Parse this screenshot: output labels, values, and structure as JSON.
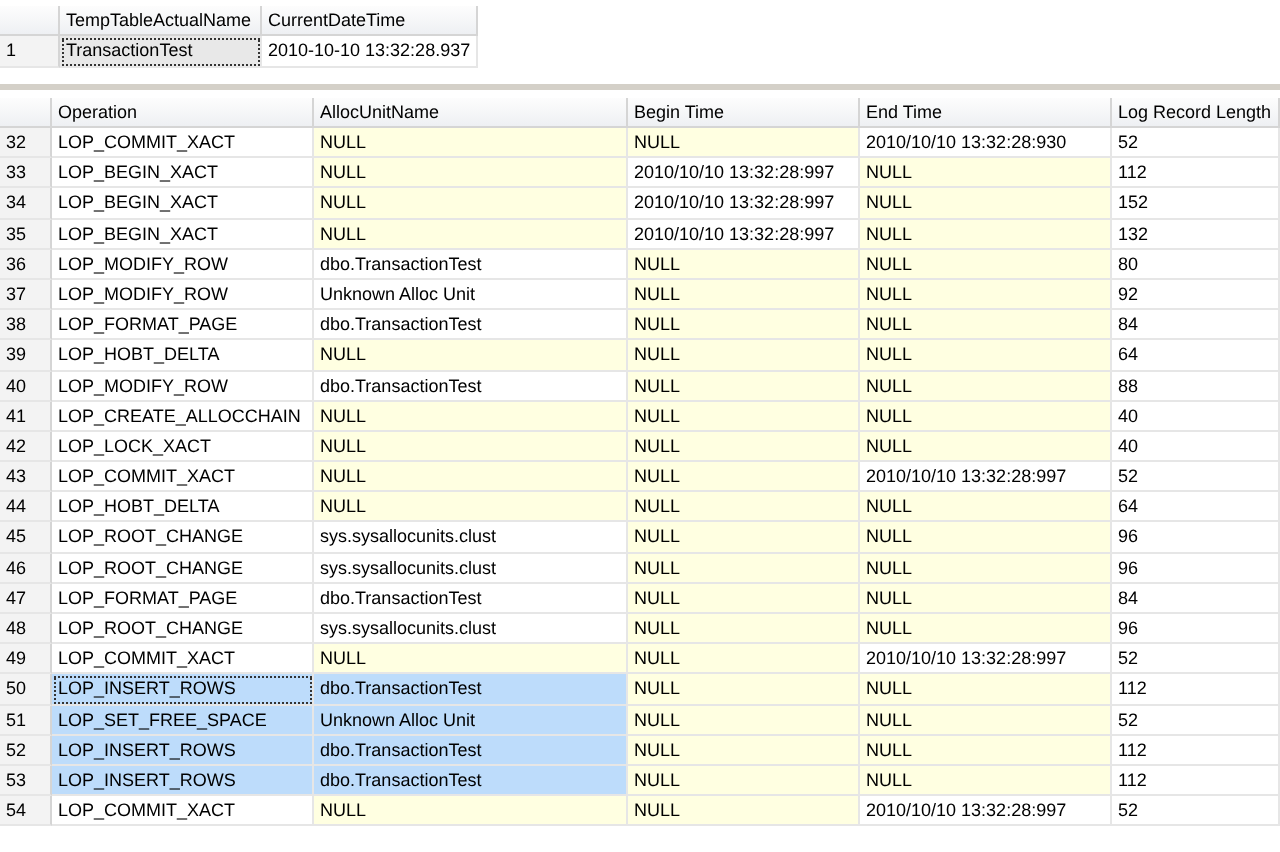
{
  "top_grid": {
    "columns": [
      {
        "label": "TempTableActualName"
      },
      {
        "label": "CurrentDateTime"
      }
    ],
    "rows": [
      {
        "num": "1",
        "cells": [
          "TransactionTest",
          "2010-10-10 13:32:28.937"
        ],
        "focused": [
          true,
          false
        ]
      }
    ]
  },
  "log_grid": {
    "columns": [
      {
        "label": "Operation",
        "selected": true
      },
      {
        "label": "AllocUnitName",
        "selected": true
      },
      {
        "label": "Begin Time",
        "selected": false
      },
      {
        "label": "End Time",
        "selected": false
      },
      {
        "label": "Log Record Length",
        "selected": false
      }
    ],
    "rows": [
      {
        "num": "32",
        "cells": [
          "LOP_COMMIT_XACT",
          "NULL",
          "NULL",
          "2010/10/10 13:32:28:930",
          "52"
        ],
        "nulls": [
          false,
          true,
          true,
          false,
          false
        ],
        "selected": false
      },
      {
        "num": "33",
        "cells": [
          "LOP_BEGIN_XACT",
          "NULL",
          "2010/10/10 13:32:28:997",
          "NULL",
          "112"
        ],
        "nulls": [
          false,
          true,
          false,
          true,
          false
        ],
        "selected": false
      },
      {
        "num": "34",
        "cells": [
          "LOP_BEGIN_XACT",
          "NULL",
          "2010/10/10 13:32:28:997",
          "NULL",
          "152"
        ],
        "nulls": [
          false,
          true,
          false,
          true,
          false
        ],
        "selected": false
      },
      {
        "num": "35",
        "cells": [
          "LOP_BEGIN_XACT",
          "NULL",
          "2010/10/10 13:32:28:997",
          "NULL",
          "132"
        ],
        "nulls": [
          false,
          true,
          false,
          true,
          false
        ],
        "selected": false
      },
      {
        "num": "36",
        "cells": [
          "LOP_MODIFY_ROW",
          "dbo.TransactionTest",
          "NULL",
          "NULL",
          "80"
        ],
        "nulls": [
          false,
          false,
          true,
          true,
          false
        ],
        "selected": false
      },
      {
        "num": "37",
        "cells": [
          "LOP_MODIFY_ROW",
          "Unknown Alloc Unit",
          "NULL",
          "NULL",
          "92"
        ],
        "nulls": [
          false,
          false,
          true,
          true,
          false
        ],
        "selected": false
      },
      {
        "num": "38",
        "cells": [
          "LOP_FORMAT_PAGE",
          "dbo.TransactionTest",
          "NULL",
          "NULL",
          "84"
        ],
        "nulls": [
          false,
          false,
          true,
          true,
          false
        ],
        "selected": false
      },
      {
        "num": "39",
        "cells": [
          "LOP_HOBT_DELTA",
          "NULL",
          "NULL",
          "NULL",
          "64"
        ],
        "nulls": [
          false,
          true,
          true,
          true,
          false
        ],
        "selected": false
      },
      {
        "num": "40",
        "cells": [
          "LOP_MODIFY_ROW",
          "dbo.TransactionTest",
          "NULL",
          "NULL",
          "88"
        ],
        "nulls": [
          false,
          false,
          true,
          true,
          false
        ],
        "selected": false
      },
      {
        "num": "41",
        "cells": [
          "LOP_CREATE_ALLOCCHAIN",
          "NULL",
          "NULL",
          "NULL",
          "40"
        ],
        "nulls": [
          false,
          true,
          true,
          true,
          false
        ],
        "selected": false
      },
      {
        "num": "42",
        "cells": [
          "LOP_LOCK_XACT",
          "NULL",
          "NULL",
          "NULL",
          "40"
        ],
        "nulls": [
          false,
          true,
          true,
          true,
          false
        ],
        "selected": false
      },
      {
        "num": "43",
        "cells": [
          "LOP_COMMIT_XACT",
          "NULL",
          "NULL",
          "2010/10/10 13:32:28:997",
          "52"
        ],
        "nulls": [
          false,
          true,
          true,
          false,
          false
        ],
        "selected": false
      },
      {
        "num": "44",
        "cells": [
          "LOP_HOBT_DELTA",
          "NULL",
          "NULL",
          "NULL",
          "64"
        ],
        "nulls": [
          false,
          true,
          true,
          true,
          false
        ],
        "selected": false
      },
      {
        "num": "45",
        "cells": [
          "LOP_ROOT_CHANGE",
          "sys.sysallocunits.clust",
          "NULL",
          "NULL",
          "96"
        ],
        "nulls": [
          false,
          false,
          true,
          true,
          false
        ],
        "selected": false
      },
      {
        "num": "46",
        "cells": [
          "LOP_ROOT_CHANGE",
          "sys.sysallocunits.clust",
          "NULL",
          "NULL",
          "96"
        ],
        "nulls": [
          false,
          false,
          true,
          true,
          false
        ],
        "selected": false
      },
      {
        "num": "47",
        "cells": [
          "LOP_FORMAT_PAGE",
          "dbo.TransactionTest",
          "NULL",
          "NULL",
          "84"
        ],
        "nulls": [
          false,
          false,
          true,
          true,
          false
        ],
        "selected": false
      },
      {
        "num": "48",
        "cells": [
          "LOP_ROOT_CHANGE",
          "sys.sysallocunits.clust",
          "NULL",
          "NULL",
          "96"
        ],
        "nulls": [
          false,
          false,
          true,
          true,
          false
        ],
        "selected": false
      },
      {
        "num": "49",
        "cells": [
          "LOP_COMMIT_XACT",
          "NULL",
          "NULL",
          "2010/10/10 13:32:28:997",
          "52"
        ],
        "nulls": [
          false,
          true,
          true,
          false,
          false
        ],
        "selected": false
      },
      {
        "num": "50",
        "cells": [
          "LOP_INSERT_ROWS",
          "dbo.TransactionTest",
          "NULL",
          "NULL",
          "112"
        ],
        "nulls": [
          false,
          false,
          true,
          true,
          false
        ],
        "selected": true,
        "focused": [
          true,
          false,
          false,
          false,
          false
        ]
      },
      {
        "num": "51",
        "cells": [
          "LOP_SET_FREE_SPACE",
          "Unknown Alloc Unit",
          "NULL",
          "NULL",
          "52"
        ],
        "nulls": [
          false,
          false,
          true,
          true,
          false
        ],
        "selected": true
      },
      {
        "num": "52",
        "cells": [
          "LOP_INSERT_ROWS",
          "dbo.TransactionTest",
          "NULL",
          "NULL",
          "112"
        ],
        "nulls": [
          false,
          false,
          true,
          true,
          false
        ],
        "selected": true
      },
      {
        "num": "53",
        "cells": [
          "LOP_INSERT_ROWS",
          "dbo.TransactionTest",
          "NULL",
          "NULL",
          "112"
        ],
        "nulls": [
          false,
          false,
          true,
          true,
          false
        ],
        "selected": true
      },
      {
        "num": "54",
        "cells": [
          "LOP_COMMIT_XACT",
          "NULL",
          "NULL",
          "2010/10/10 13:32:28:997",
          "52"
        ],
        "nulls": [
          false,
          true,
          true,
          false,
          false
        ],
        "selected": false
      }
    ]
  }
}
